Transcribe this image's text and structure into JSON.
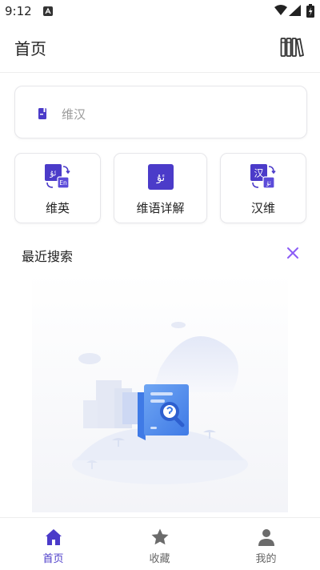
{
  "status_bar": {
    "time": "9:12"
  },
  "app_bar": {
    "title": "首页"
  },
  "search": {
    "placeholder": "维汉"
  },
  "modes": [
    {
      "label": "维英",
      "icon": "uyghur-english-icon"
    },
    {
      "label": "维语详解",
      "icon": "uyghur-detail-icon"
    },
    {
      "label": "汉维",
      "icon": "chinese-uyghur-icon"
    }
  ],
  "icon_glyphs": {
    "uyghur": "ئۇ",
    "english": "En",
    "chinese": "汉"
  },
  "recent": {
    "title": "最近搜索"
  },
  "bottom_nav": [
    {
      "label": "首页",
      "icon": "home-icon",
      "active": true
    },
    {
      "label": "收藏",
      "icon": "star-icon",
      "active": false
    },
    {
      "label": "我的",
      "icon": "person-icon",
      "active": false
    }
  ],
  "colors": {
    "accent": "#4b3bc9",
    "inactive": "#666666"
  }
}
